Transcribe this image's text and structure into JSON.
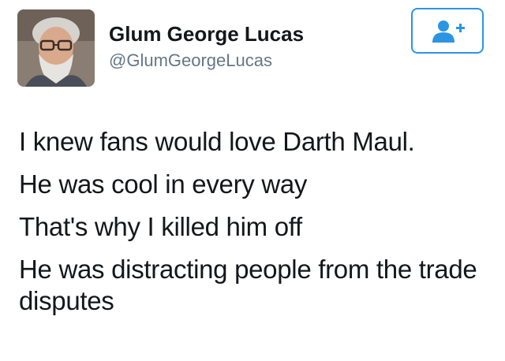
{
  "user": {
    "display_name": "Glum George Lucas",
    "handle": "@GlumGeorgeLucas",
    "avatar_icon": "profile-photo-icon"
  },
  "follow_button": {
    "icon": "add-user-icon"
  },
  "tweet": {
    "lines": [
      "I knew fans would love Darth Maul.",
      "He was cool in every way",
      "That's why I killed him off",
      "He was distracting people from the trade disputes"
    ]
  },
  "colors": {
    "text": "#14171a",
    "handle": "#657786",
    "accent": "#2b95e3"
  }
}
